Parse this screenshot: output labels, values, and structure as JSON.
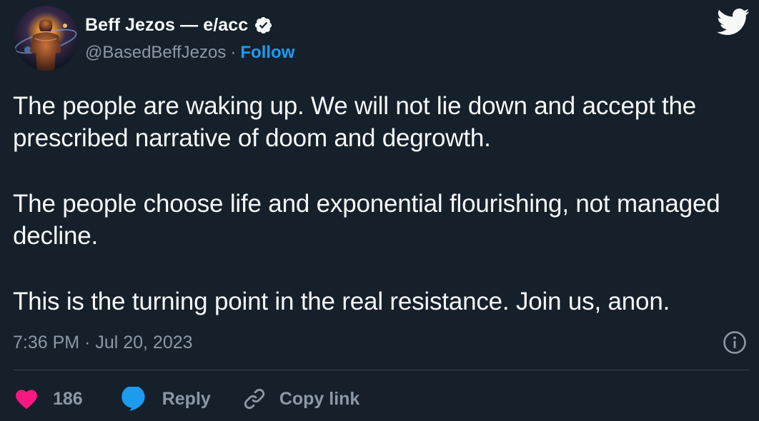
{
  "author": {
    "display_name": "Beff Jezos — e/acc",
    "handle": "@BasedBeffJezos",
    "separator": "·",
    "follow_label": "Follow",
    "verified": true
  },
  "tweet": {
    "paragraphs": [
      "The people are waking up. We will not lie down and accept the prescribed narrative of doom and degrowth.",
      "The people choose life and exponential flourishing, not managed decline.",
      "This is the turning point in the real resistance. Join us, anon."
    ],
    "timestamp": "7:36 PM · Jul 20, 2023"
  },
  "actions": {
    "like_count": "186",
    "reply_label": "Reply",
    "copy_link_label": "Copy link"
  },
  "colors": {
    "background": "#15202b",
    "text": "#f7f9f9",
    "secondary": "#8b98a5",
    "accent": "#1d9bf0",
    "like": "#f91880",
    "divider": "#38444d"
  },
  "icons": {
    "verified": "verified-badge-icon",
    "brand": "twitter-bird-icon",
    "info": "info-icon",
    "like": "heart-icon",
    "reply": "speech-bubble-icon",
    "copy": "link-icon"
  }
}
